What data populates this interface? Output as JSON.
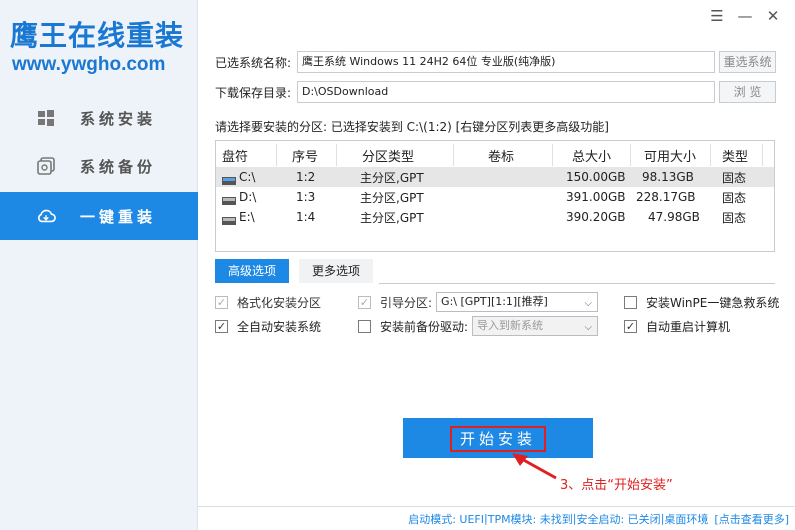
{
  "app": {
    "title": "鹰王在线重装",
    "url": "www.ywgho.com"
  },
  "colors": {
    "accent": "#1e88e5",
    "annotation": "#e02020"
  },
  "nav": {
    "items": [
      {
        "label": "系统安装",
        "icon": "windows-icon",
        "active": false
      },
      {
        "label": "系统备份",
        "icon": "backup-icon",
        "active": false
      },
      {
        "label": "一键重装",
        "icon": "cloud-icon",
        "active": true
      }
    ]
  },
  "window": {
    "menu_icon": "☰",
    "minimize_icon": "—",
    "close_icon": "✕"
  },
  "form": {
    "system_label": "已选系统名称:",
    "system_value": "鹰王系统 Windows 11 24H2   64位 专业版(纯净版)",
    "reselect_button": "重选系统",
    "dir_label": "下载保存目录:",
    "dir_value": "D:\\OSDownload",
    "browse_button": "浏 览"
  },
  "partition": {
    "hint": "请选择要安装的分区: 已选择安装到 C:\\(1:2) [右键分区列表更多高级功能]",
    "columns": [
      "盘符",
      "序号",
      "分区类型",
      "卷标",
      "总大小",
      "可用大小",
      "类型"
    ],
    "rows": [
      {
        "drive": "C:\\",
        "index": "1:2",
        "ptype": "主分区,GPT",
        "label": "",
        "total": "150.00GB",
        "free": "98.13GB",
        "kind": "固态",
        "selected": true
      },
      {
        "drive": "D:\\",
        "index": "1:3",
        "ptype": "主分区,GPT",
        "label": "",
        "total": "391.00GB",
        "free": "228.17GB",
        "kind": "固态",
        "selected": false
      },
      {
        "drive": "E:\\",
        "index": "1:4",
        "ptype": "主分区,GPT",
        "label": "",
        "total": "390.20GB",
        "free": "47.98GB",
        "kind": "固态",
        "selected": false
      }
    ]
  },
  "tabs": {
    "advanced": "高级选项",
    "more": "更多选项"
  },
  "options": {
    "format_partition": {
      "label": "格式化安装分区",
      "checked": true,
      "disabled": true
    },
    "boot_partition": {
      "label": "引导分区:",
      "checked": true,
      "disabled": true
    },
    "boot_partition_value": "G:\\ [GPT][1:1][推荐]",
    "install_winpe": {
      "label": "安装WinPE一键急救系统",
      "checked": false
    },
    "auto_install": {
      "label": "全自动安装系统",
      "checked": true
    },
    "backup_drivers": {
      "label": "安装前备份驱动:",
      "checked": false
    },
    "backup_drivers_value": "导入到新系统",
    "auto_restart": {
      "label": "自动重启计算机",
      "checked": true
    }
  },
  "start_button": "开始安装",
  "annotation": "3、点击“开始安装”",
  "status": {
    "boot_mode": "启动模式: UEFI",
    "tpm": "TPM模块: 未找到",
    "secure_boot": "安全启动: 已关闭",
    "environment": "桌面环境",
    "more_link": "[点击查看更多]"
  }
}
